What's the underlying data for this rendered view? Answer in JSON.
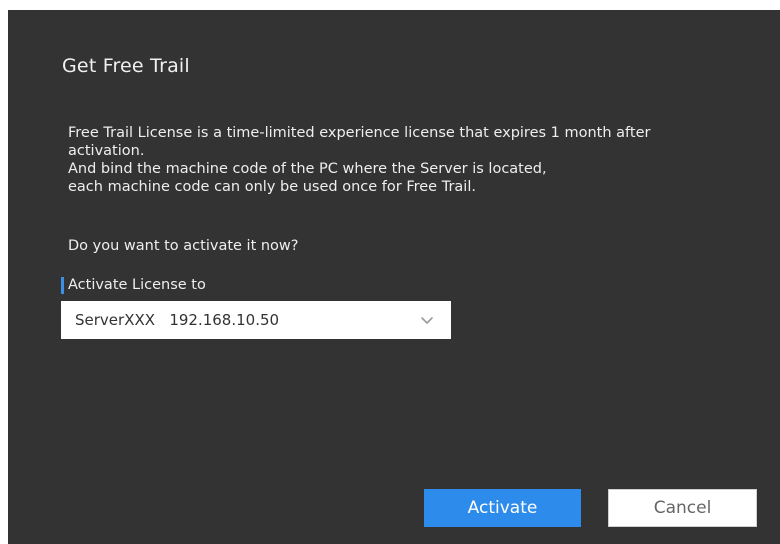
{
  "dialog": {
    "title": "Get Free Trail",
    "description_lines": [
      "Free Trail License is a time-limited experience license that expires 1 month after activation.",
      "And bind the machine code of the PC where the Server is located,",
      "each machine code can only be used once for Free Trail."
    ],
    "question": "Do you want to activate it now?",
    "field_label": "Activate License to",
    "select_value": "ServerXXX   192.168.10.50",
    "activate_label": "Activate",
    "cancel_label": "Cancel"
  },
  "colors": {
    "dialog_bg": "#333333",
    "accent": "#2d8ceb",
    "label_marker": "#3d8fe6"
  },
  "icons": {
    "select_chevron": "chevron-down-icon"
  }
}
